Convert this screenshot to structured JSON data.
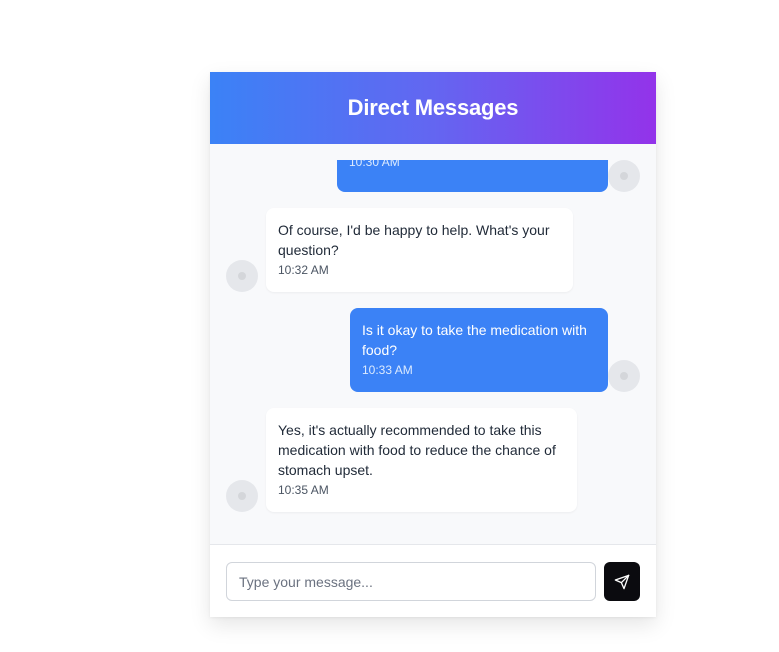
{
  "header": {
    "title": "Direct Messages"
  },
  "messages": [
    {
      "direction": "outgoing",
      "text": "",
      "time": "10:30 AM"
    },
    {
      "direction": "incoming",
      "text": "Of course, I'd be happy to help. What's your question?",
      "time": "10:32 AM"
    },
    {
      "direction": "outgoing",
      "text": "Is it okay to take the medication with food?",
      "time": "10:33 AM"
    },
    {
      "direction": "incoming",
      "text": "Yes, it's actually recommended to take this medication with food to reduce the chance of stomach upset.",
      "time": "10:35 AM"
    }
  ],
  "composer": {
    "placeholder": "Type your message...",
    "value": "",
    "send_icon": "send-icon"
  },
  "colors": {
    "accent": "#3b82f6",
    "gradient_start": "#3b82f6",
    "gradient_end": "#9333ea",
    "send_button": "#0b0b0f"
  }
}
